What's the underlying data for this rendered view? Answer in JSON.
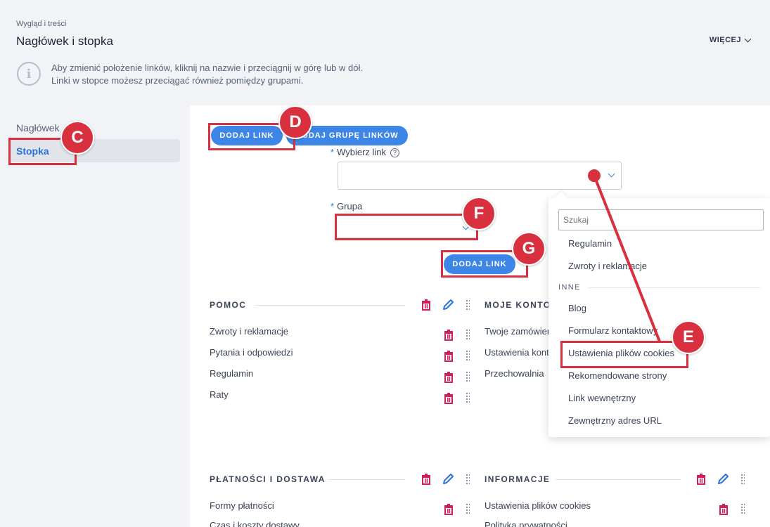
{
  "header": {
    "breadcrumb": "Wygląd i treści",
    "title": "Nagłówek i stopka",
    "more_label": "WIĘCEJ",
    "info_line1": "Aby zmienić położenie linków, kliknij na nazwie i przeciągnij w górę lub w dół.",
    "info_line2": "Linki w stopce możesz przeciągać również pomiędzy grupami."
  },
  "sidebar": {
    "items": [
      {
        "label": "Nagłówek"
      },
      {
        "label": "Stopka"
      }
    ]
  },
  "toolbar": {
    "add_link_label": "DODAJ LINK",
    "add_group_label": "DODAJ GRUPĘ LINKÓW"
  },
  "form": {
    "choose_link_label": "Wybierz link",
    "group_label": "Grupa",
    "submit_label": "DODAJ LINK",
    "required_mark": "*",
    "help_mark": "?"
  },
  "dropdown": {
    "search_placeholder": "Szukaj",
    "items_top": [
      "Regulamin",
      "Zwroty i reklamacje"
    ],
    "group_name": "INNE",
    "items_other": [
      "Blog",
      "Formularz kontaktowy",
      "Ustawienia plików cookies",
      "Rekomendowane strony",
      "Link wewnętrzny",
      "Zewnętrzny adres URL"
    ]
  },
  "groups": [
    {
      "title": "POMOC",
      "links": [
        "Zwroty i reklamacje",
        "Pytania i odpowiedzi",
        "Regulamin",
        "Raty"
      ]
    },
    {
      "title": "MOJE KONTO",
      "links": [
        "Twoje zamówienia",
        "Ustawienia konta",
        "Przechowalnia"
      ]
    },
    {
      "title": "PŁATNOŚCI I DOSTAWA",
      "links": [
        "Formy płatności",
        "Czas i koszty dostawy"
      ]
    },
    {
      "title": "INFORMACJE",
      "links": [
        "Ustawienia plików cookies",
        "Polityka prywatności"
      ]
    }
  ],
  "annotations": {
    "c": "C",
    "d": "D",
    "e": "E",
    "f": "F",
    "g": "G"
  },
  "colors": {
    "accent": "#3d86e8",
    "danger": "#d01f5c",
    "annotation": "#d8303f"
  }
}
